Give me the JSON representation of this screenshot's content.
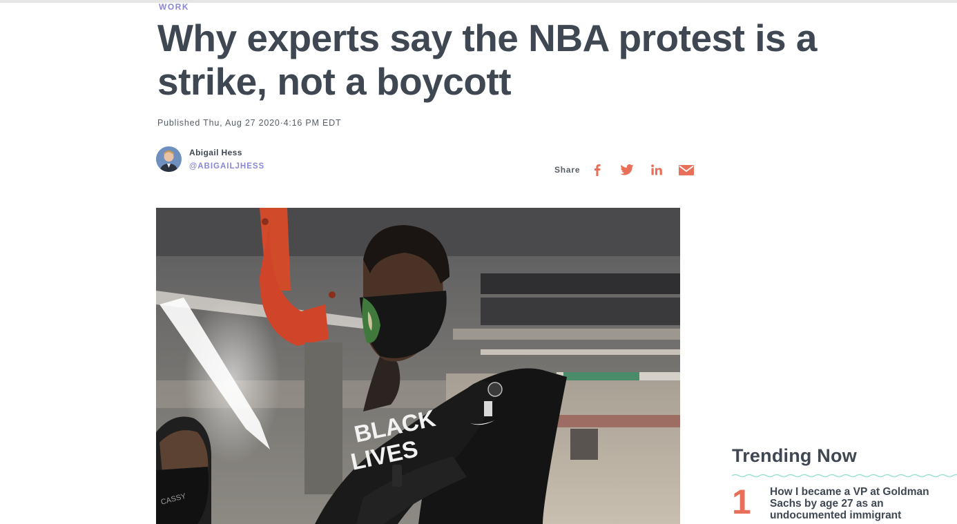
{
  "article": {
    "category": "WORK",
    "headline": "Why experts say the NBA protest is a strike, not a boycott",
    "published": "Published Thu, Aug 27 2020·4:16 PM EDT"
  },
  "author": {
    "name": "Abigail Hess",
    "handle": "@ABIGAILJHESS"
  },
  "share": {
    "label": "Share",
    "buttons": [
      "facebook-icon",
      "twitter-icon",
      "linkedin-icon",
      "email-icon"
    ],
    "icon_color": "#e8705a"
  },
  "trending": {
    "title": "Trending Now",
    "items": [
      {
        "rank": "1",
        "title": "How I became a VP at Goldman Sachs by age 27 as an undocumented immigrant"
      }
    ]
  },
  "colors": {
    "accent": "#8a86d6",
    "headline": "#3f4753",
    "trending_rank": "#e8705a",
    "wave": "#9fe0d6"
  }
}
